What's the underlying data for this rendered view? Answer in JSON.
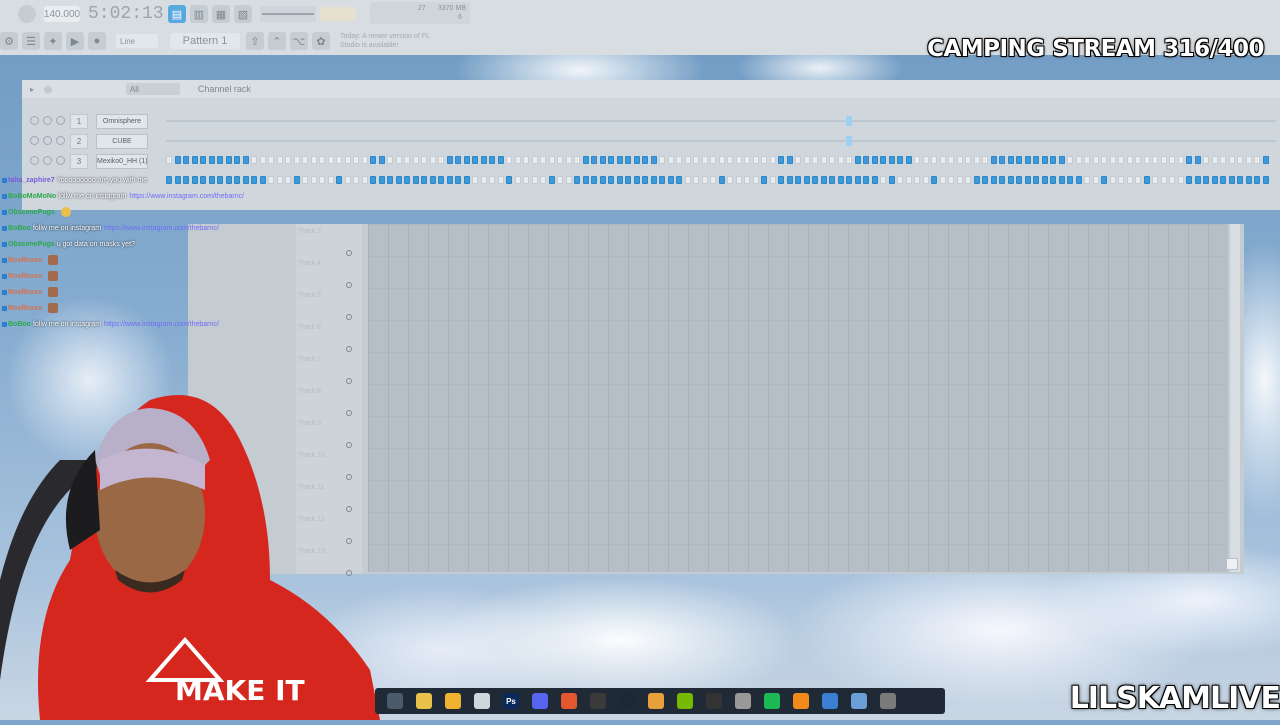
{
  "toolbar": {
    "tempo": "140.000",
    "time": "5:02:13",
    "pattern": "Pattern 1",
    "snap": "Line",
    "monitor_cpu": "27",
    "monitor_mem": "3370 MB",
    "monitor_poly": "6",
    "notice": "Today: A newer version of FL Studio is available!"
  },
  "overlay": {
    "stream_title": "CAMPING STREAM 316/400",
    "brand": "LILSKAMLIVE"
  },
  "channel_rack": {
    "filter": "All",
    "title": "Channel rack",
    "channels": [
      {
        "num": "1",
        "name": "Omnisphere"
      },
      {
        "num": "2",
        "name": "CUBE"
      },
      {
        "num": "3",
        "name": "Mexiko0_HH (1)"
      }
    ]
  },
  "playlist": {
    "tracks": [
      "Track 3",
      "Track 4",
      "Track 5",
      "Track 6",
      "Track 7",
      "Track 8",
      "Track 9",
      "Track 10",
      "Track 11",
      "Track 12",
      "Track 13"
    ]
  },
  "chat": {
    "messages": [
      {
        "user": "taha_zaphire7",
        "text": "Yooooooooo are you with me",
        "link": "",
        "emote": false,
        "style": "p"
      },
      {
        "user": "BoBoMoMoNo",
        "text": "follw me on instagram",
        "link": "https://www.instagram.com/thebarnc/",
        "emote": false,
        "style": "g"
      },
      {
        "user": "ObscenePugs",
        "text": "",
        "link": "",
        "emote": true,
        "style": "g"
      },
      {
        "user": "BoBoo",
        "text": "follw me on instagram",
        "link": "https://www.instagram.com/thebarnc/",
        "emote": false,
        "style": "g"
      },
      {
        "user": "ObscenePugs",
        "text": "u got data on masks yet?",
        "link": "",
        "emote": false,
        "style": "g"
      },
      {
        "user": "RoxRoxxx",
        "text": "",
        "link": "",
        "emote": true,
        "style": "r"
      },
      {
        "user": "RoxRoxxx",
        "text": "",
        "link": "",
        "emote": true,
        "style": "r"
      },
      {
        "user": "RoxRoxxx",
        "text": "",
        "link": "",
        "emote": true,
        "style": "r"
      },
      {
        "user": "RoxRoxxx",
        "text": "",
        "link": "",
        "emote": true,
        "style": "r"
      },
      {
        "user": "BoBoo",
        "text": "follw me on instagram",
        "link": "https://www.instagram.com/thebarnc/",
        "emote": false,
        "style": "g"
      }
    ]
  },
  "webcam": {
    "shirt_text": "MAKE IT"
  },
  "taskbar": {
    "icons": [
      "steam-icon",
      "chrome-icon",
      "folder-icon",
      "clipboard-icon",
      "photoshop-icon",
      "discord-icon",
      "brave-icon",
      "obs-icon",
      "steam-alt-icon",
      "winamp-icon",
      "nvidia-icon",
      "ableton-icon",
      "cubase-icon",
      "spotify-icon",
      "flstudio-icon",
      "paint-icon",
      "notepad-icon",
      "media-player-icon"
    ],
    "labels": [
      "",
      "",
      "",
      "",
      "Ps",
      "",
      "",
      "",
      "",
      "",
      "",
      "",
      "",
      "",
      "",
      "",
      "",
      ""
    ]
  }
}
